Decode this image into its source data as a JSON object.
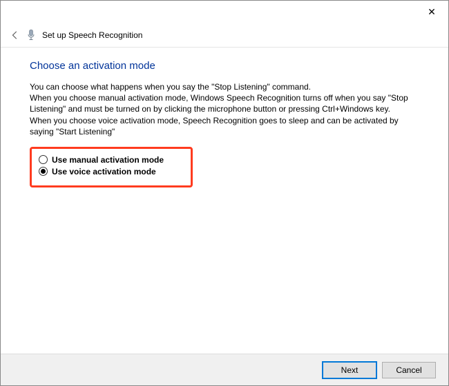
{
  "titlebar": {
    "close_char": "✕"
  },
  "header": {
    "title": "Set up Speech Recognition"
  },
  "main": {
    "heading": "Choose an activation mode",
    "desc_line1": "You can choose what happens when you say the \"Stop Listening\" command.",
    "desc_line2": "When you choose manual activation mode, Windows Speech Recognition turns off when you say \"Stop Listening\" and must be turned on by clicking the microphone button or pressing Ctrl+Windows key.",
    "desc_line3": "When you choose voice activation mode, Speech Recognition goes to sleep and can be activated by saying \"Start Listening\"",
    "options": {
      "manual": {
        "label": "Use manual activation mode",
        "checked": false
      },
      "voice": {
        "label": "Use voice activation mode",
        "checked": true
      }
    }
  },
  "footer": {
    "next_label": "Next",
    "cancel_label": "Cancel"
  }
}
